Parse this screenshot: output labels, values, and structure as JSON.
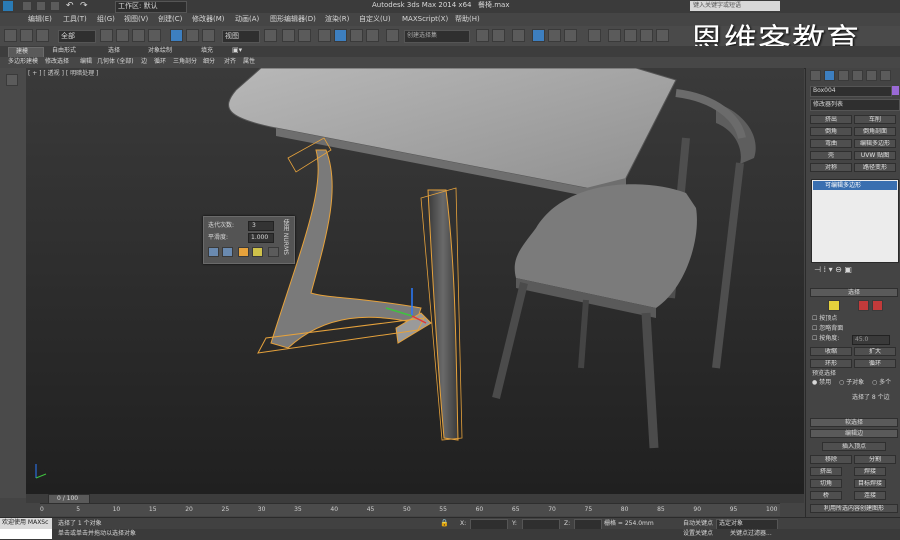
{
  "window": {
    "app_title": "Autodesk 3ds Max 2014 x64",
    "file_name": "餐椅.max",
    "workspace_label": "工作区: 默认",
    "search_placeholder": "键入关键字或短语"
  },
  "menu": [
    "编辑(E)",
    "工具(T)",
    "组(G)",
    "视图(V)",
    "创建(C)",
    "修改器(M)",
    "动画(A)",
    "图形编辑器(D)",
    "渲染(R)",
    "自定义(U)",
    "MAXScript(X)",
    "帮助(H)"
  ],
  "toolbar": {
    "selection_filter": "全部",
    "reference_coord": "视图",
    "named_selection_placeholder": "创建选择集"
  },
  "ribbon": {
    "tabs": [
      "建模",
      "自由形式",
      "选择",
      "对象绘制",
      "填充"
    ],
    "subtabs": [
      "多边形建模",
      "修改选择",
      "编辑",
      "几何体 (全部)",
      "边",
      "循环",
      "三角剖分",
      "细分",
      "对齐",
      "属性"
    ]
  },
  "viewport": {
    "label": "[ + ] [ 透视 ] [ 明暗处理 ]",
    "caddy": {
      "iterations_label": "迭代次数:",
      "iterations_value": "3",
      "smoothness_label": "平滑度:",
      "smoothness_value": "1.000",
      "side_label": "使用 NURMS"
    }
  },
  "watermark": "恩维客教育",
  "right_panel": {
    "object_name": "Box004",
    "modifier_list_label": "修改器列表",
    "modifier_buttons": [
      [
        "挤出",
        "车削"
      ],
      [
        "倒角",
        "倒角剖面"
      ],
      [
        "弯曲",
        "编辑多边形"
      ],
      [
        "壳",
        "UVW 贴图"
      ],
      [
        "对称",
        "路径变形"
      ]
    ],
    "stack_item": "可编辑多边形",
    "selection_rollout": {
      "title": "选择",
      "by_vertex": "按顶点",
      "ignore_backfacing": "忽略背面",
      "by_angle": "按角度:",
      "angle_value": "45.0",
      "shrink": "收缩",
      "grow": "扩大",
      "ring": "环形",
      "loop": "循环",
      "preview_label": "预览选择",
      "preview_options": [
        "禁用",
        "子对象",
        "多个"
      ],
      "status": "选择了 8 个边"
    },
    "soft_selection_title": "软选择",
    "edit_edges": {
      "title": "编辑边",
      "insert_vertex": "插入顶点",
      "remove": "移除",
      "split": "分割",
      "extrude": "挤出",
      "weld": "焊接",
      "chamfer": "切角",
      "target_weld": "目标焊接",
      "bridge": "桥",
      "connect": "连接",
      "create_shape": "利用所选内容创建图形"
    }
  },
  "timeline": {
    "frame": "0 / 100",
    "ruler_ticks": [
      "0",
      "5",
      "10",
      "15",
      "20",
      "25",
      "30",
      "35",
      "40",
      "45",
      "50",
      "55",
      "60",
      "65",
      "70",
      "75",
      "80",
      "85",
      "90",
      "95",
      "100"
    ]
  },
  "status": {
    "welcome": "欢迎使用 MAXSc",
    "selection_msg": "选择了 1 个对象",
    "prompt_msg": "单击或单击并拖动以选择对象",
    "x_label": "X:",
    "y_label": "Y:",
    "z_label": "Z:",
    "grid": "栅格 = 254.0mm",
    "auto_key": "自动关键点",
    "selected_dropdown": "选定对象",
    "set_key": "设置关键点",
    "key_filters": "关键点过滤器..."
  }
}
